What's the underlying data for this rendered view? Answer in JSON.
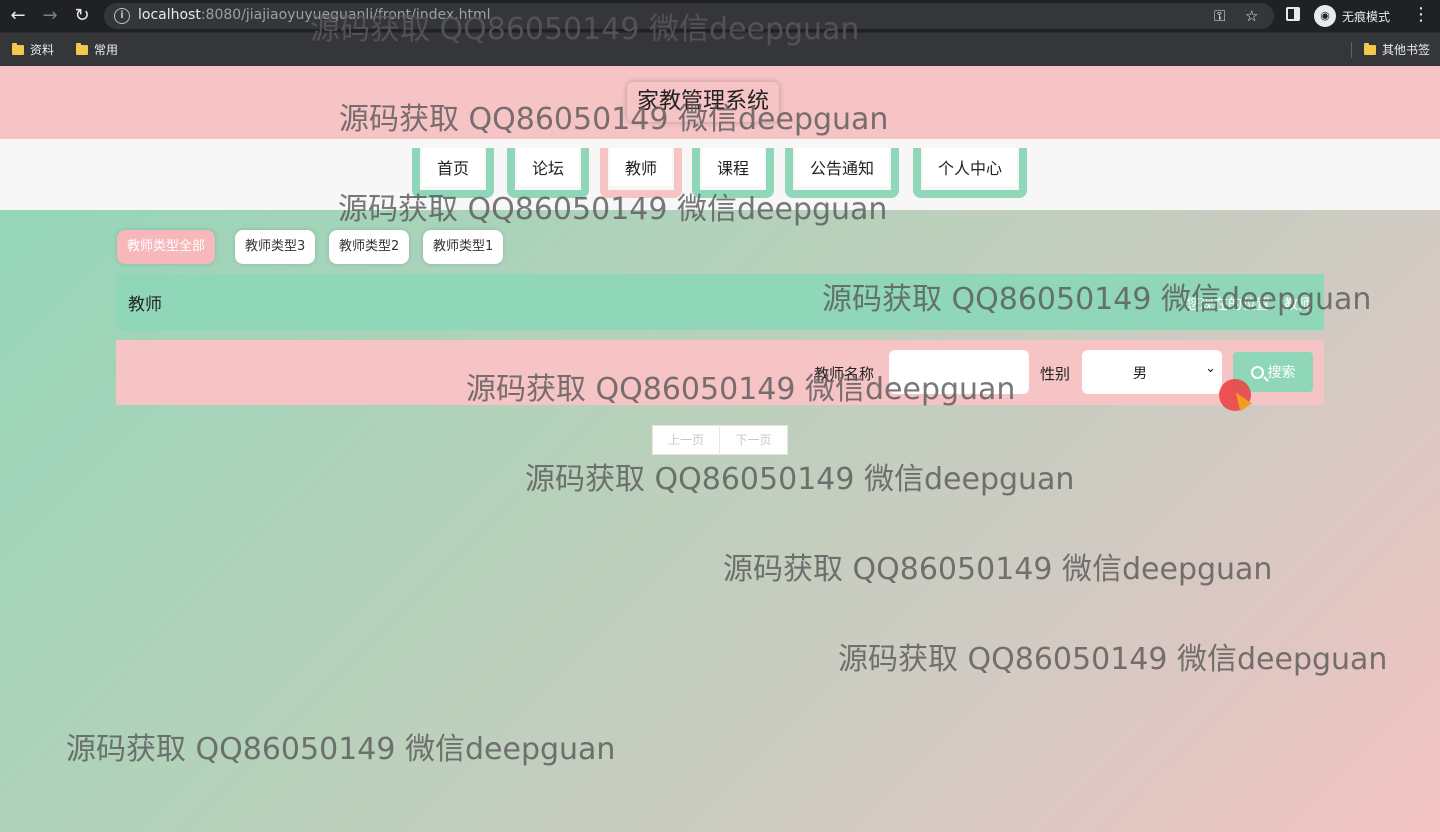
{
  "browser": {
    "url_host": "localhost",
    "url_path": ":8080/jiajiaoyuyueguanli/front/index.html",
    "incognito_label": "无痕模式",
    "bookmarks": [
      "资料",
      "常用"
    ],
    "other_bookmarks": "其他书签"
  },
  "site": {
    "title": "家教管理系统",
    "nav": [
      "首页",
      "论坛",
      "教师",
      "课程",
      "公告通知",
      "个人中心"
    ],
    "active_nav": "教师"
  },
  "type_tags": [
    "教师类型全部",
    "教师类型3",
    "教师类型2",
    "教师类型1"
  ],
  "section": {
    "title": "教师",
    "breadcrumb": "您现在的位置：教师"
  },
  "search": {
    "name_label": "教师名称",
    "name_value": "",
    "gender_label": "性别",
    "gender_selected": "男",
    "button_label": "搜索"
  },
  "pager": {
    "prev": "上一页",
    "next": "下一页"
  },
  "watermark": "源码获取 QQ86050149 微信deepguan",
  "colors": {
    "mint": "#8fd7b8",
    "pink": "#f6c4c5"
  }
}
